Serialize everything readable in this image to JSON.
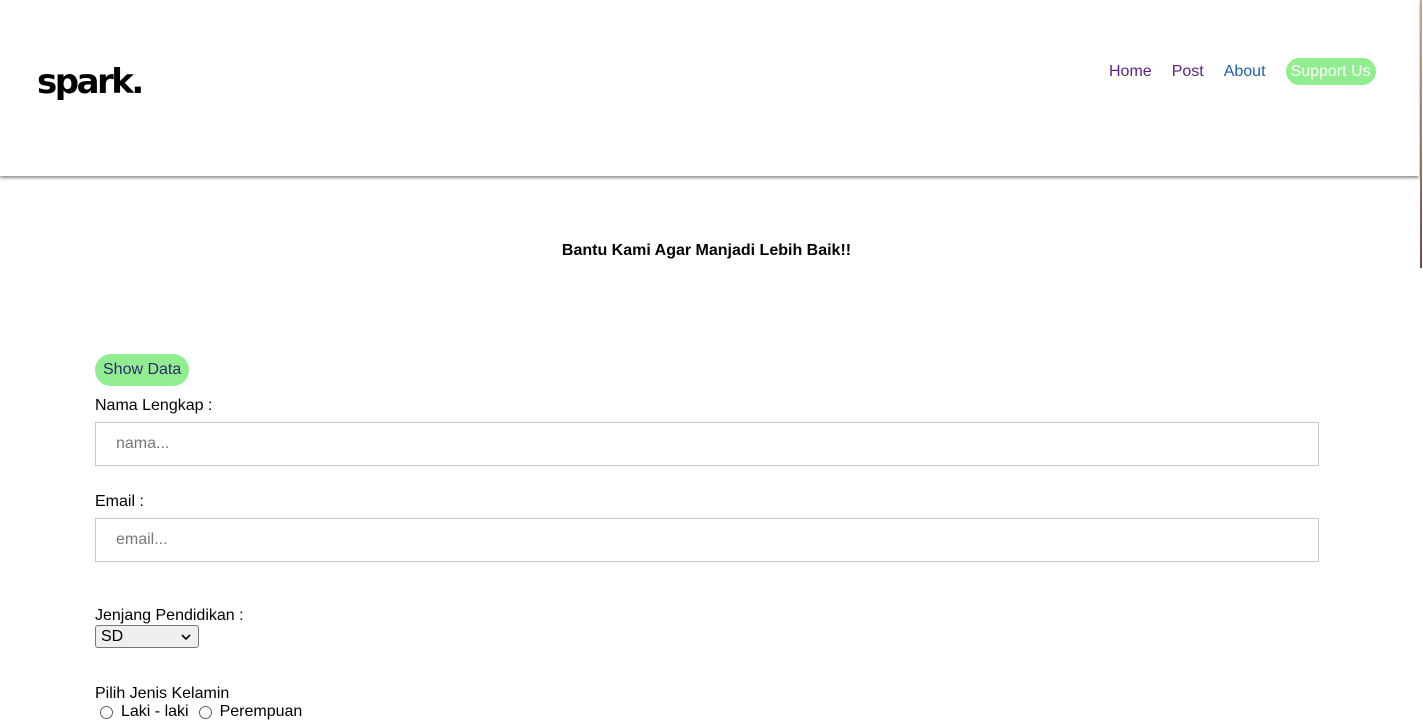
{
  "header": {
    "logo_text": "spark.",
    "nav": {
      "home": "Home",
      "post": "Post",
      "about": "About",
      "support": "Support Us"
    }
  },
  "main": {
    "heading": "Bantu Kami Agar Manjadi Lebih Baik!!",
    "show_data_label": "Show Data",
    "name_label": "Nama Lengkap :",
    "name_placeholder": "nama...",
    "email_label": "Email :",
    "email_placeholder": "email...",
    "education_label": "Jenjang Pendidikan :",
    "education_selected": "SD",
    "gender_label": "Pilih Jenis Kelamin",
    "gender_options": [
      "Laki - laki",
      "Perempuan"
    ]
  },
  "colors": {
    "accent_green": "#90ee90",
    "nav_visited": "#5b1f8a",
    "nav_link": "#1a5fb4"
  }
}
